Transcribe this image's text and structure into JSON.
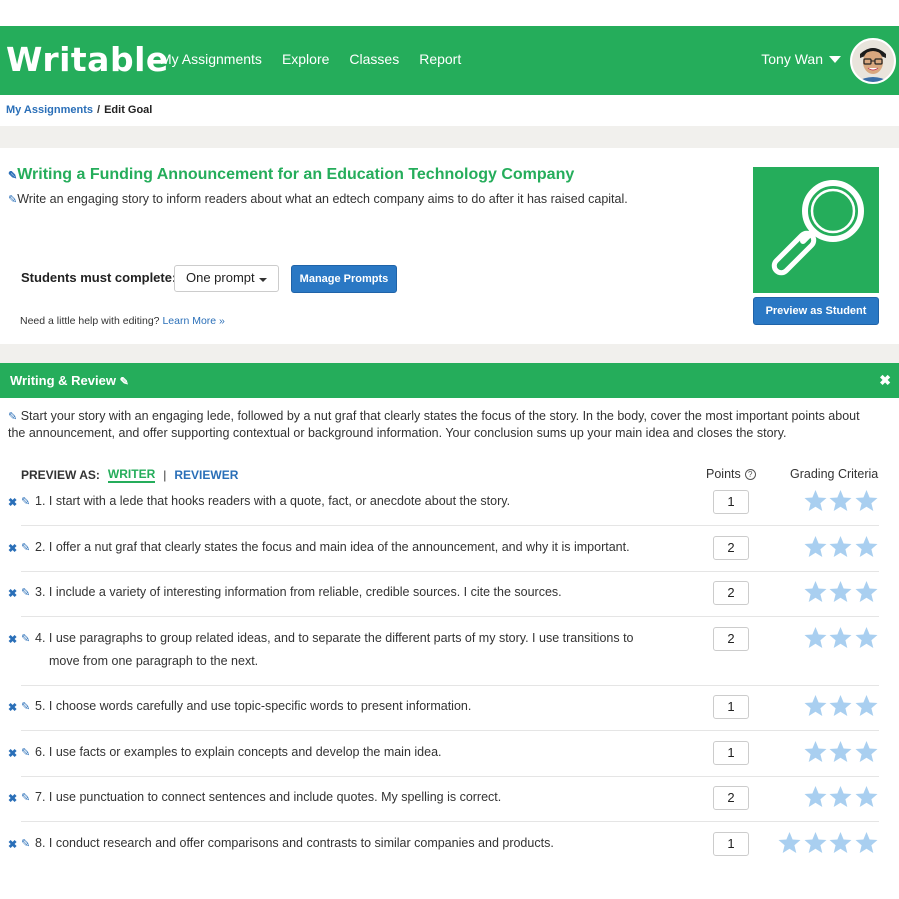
{
  "app": {
    "logo": "Writable",
    "nav": [
      "My Assignments",
      "Explore",
      "Classes",
      "Report"
    ],
    "user": "Tony Wan"
  },
  "breadcrumb": {
    "link": "My Assignments",
    "separator": "/",
    "current": "Edit Goal"
  },
  "goal": {
    "title": "Writing a Funding Announcement for an Education Technology Company",
    "description": "Write an engaging story to inform readers about what an edtech company aims to do after it has raised capital.",
    "must_complete_label": "Students must complete:",
    "must_complete_value": "One prompt",
    "manage_prompts": "Manage Prompts",
    "help_text": "Need a little help with editing?",
    "help_link": "Learn More »",
    "preview_as_student": "Preview as Student",
    "image_icon": "magnifier-icon"
  },
  "writing_review": {
    "title": "Writing & Review",
    "description": "Start your story with an engaging lede, followed by a nut graf that clearly states the focus of the story. In the body, cover the most important points about the announcement, and offer supporting contextual or background information. Your conclusion sums up your main idea and closes the story.",
    "preview_as": "PREVIEW AS:",
    "writer": "WRITER",
    "separator": "|",
    "reviewer": "REVIEWER",
    "points_label": "Points",
    "grading_label": "Grading Criteria",
    "criteria": [
      {
        "text": "1. I start with a lede that hooks readers with a quote, fact, or anecdote about the story.",
        "points": "1",
        "stars": 3
      },
      {
        "text": "2. I offer a nut graf that clearly states the focus and main idea of the announcement, and why it is important.",
        "points": "2",
        "stars": 3
      },
      {
        "text": "3. I include a variety of interesting information from reliable, credible sources. I cite the sources.",
        "points": "2",
        "stars": 3
      },
      {
        "text": "4. I use paragraphs to group related ideas, and to separate the different parts of my story. I use transitions to",
        "text2": "move from one paragraph to the next.",
        "points": "2",
        "stars": 3
      },
      {
        "text": "5. I choose words carefully and use topic-specific words to present information.",
        "points": "1",
        "stars": 3
      },
      {
        "text": "6. I use facts or examples to explain concepts and develop the main idea.",
        "points": "1",
        "stars": 3
      },
      {
        "text": "7. I use punctuation to connect sentences and include quotes. My spelling is correct.",
        "points": "2",
        "stars": 3
      },
      {
        "text": "8. I conduct research and offer comparisons and contrasts to similar companies and products.",
        "points": "1",
        "stars": 4
      }
    ]
  },
  "colors": {
    "brand_green": "#25ad5b",
    "link_blue": "#2a6fb8",
    "button_blue": "#2a78c4",
    "star_blue": "#a9cff0"
  }
}
